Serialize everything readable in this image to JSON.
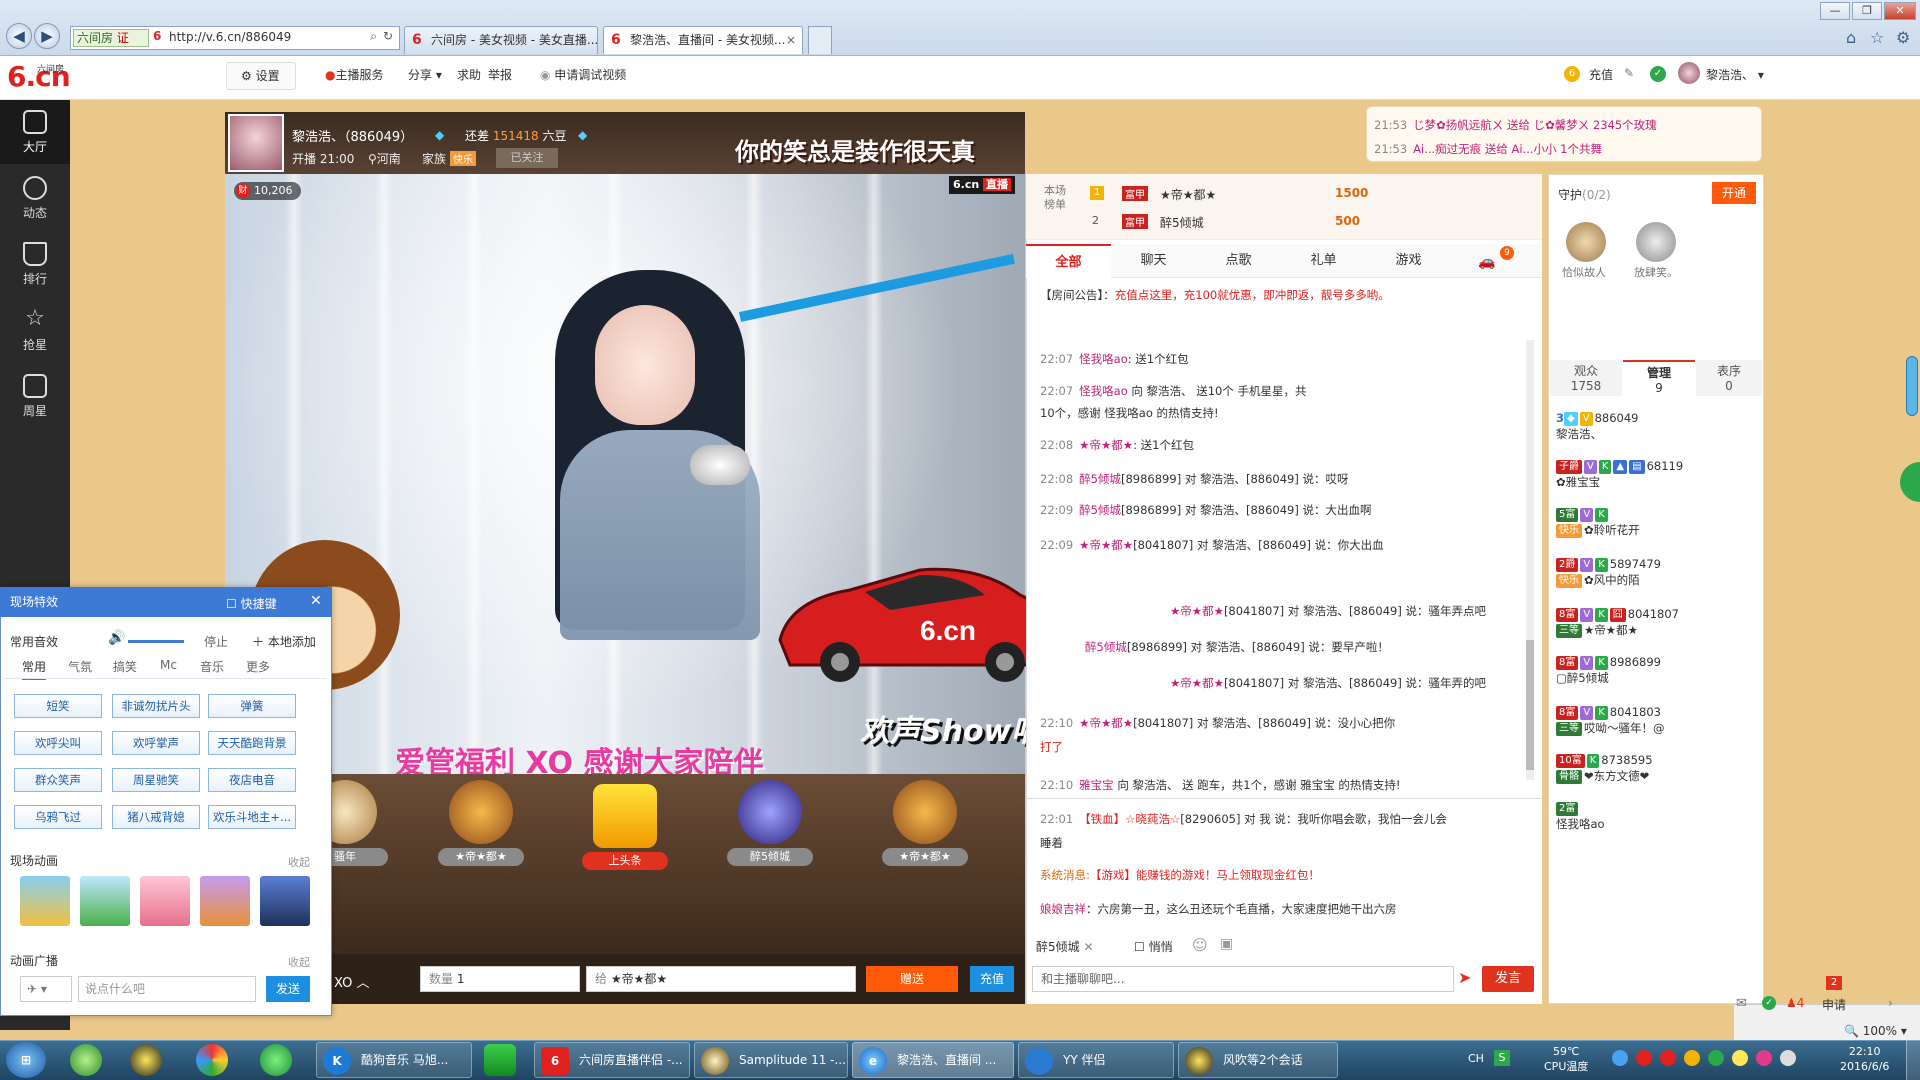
{
  "browser": {
    "url": "http://v.6.cn/886049",
    "zone": "六间房",
    "zone_badge": "证",
    "tabs": [
      {
        "title": "六间房 - 美女视频 - 美女直播..."
      },
      {
        "title": "黎浩浩、直播间 - 美女视频..."
      }
    ],
    "close_glyph": "×"
  },
  "site": {
    "logo_text": "6.cn",
    "logo_small": "六间房",
    "settings": "设置",
    "anchor_service": "主播服务",
    "share": "分享",
    "help": "求助",
    "report": "举报",
    "apply_debug": "申请调试视频",
    "recharge": "充值",
    "username": "黎浩浩、"
  },
  "rail": [
    {
      "label": "大厅"
    },
    {
      "label": "动态"
    },
    {
      "label": "排行"
    },
    {
      "label": "抢星"
    },
    {
      "label": "周星"
    }
  ],
  "anchor": {
    "name": "黎浩浩、（886049）",
    "diff_label": "还差",
    "diff_value": "151418",
    "diff_unit": "六豆",
    "start_time": "开播 21:00",
    "location": "河南",
    "family": "家族",
    "family_badge": "快乐",
    "follow": "已关注",
    "fans_count": "10,206",
    "fans_badge": "财",
    "banner": "你的笑总是装作很天真",
    "video_logo": "6.cn",
    "video_live": "直播"
  },
  "video": {
    "bottom_text": "爱管福利 XO  感谢大家陪伴",
    "show_logo": "欢声Show唱"
  },
  "gift_slots": [
    {
      "name": "骚年"
    },
    {
      "name": "★帝★都★"
    },
    {
      "name": "上头条"
    },
    {
      "name": "醉5倾城"
    },
    {
      "name": "★帝★都★"
    }
  ],
  "controls": {
    "song": "XO",
    "quantity_label": "数量",
    "quantity_value": "1",
    "to_label": "给",
    "to_value": "★帝★都★",
    "give": "赠送",
    "recharge": "充值"
  },
  "rank": {
    "label": "本场榜单",
    "rows": [
      {
        "rank": "1",
        "lv": "富甲",
        "name": "★帝★都★",
        "score": "1500"
      },
      {
        "rank": "2",
        "lv": "富甲",
        "name": "醉5倾城",
        "score": "500"
      }
    ]
  },
  "chat_tabs": [
    {
      "label": "全部"
    },
    {
      "label": "聊天"
    },
    {
      "label": "点歌"
    },
    {
      "label": "礼单"
    },
    {
      "label": "游戏"
    }
  ],
  "car_badge": "9",
  "notice": {
    "label": "【房间公告】：",
    "text": "充值点这里，充100就优惠，即冲即返，靓号多多哟。"
  },
  "messages": [
    {
      "time": "22:07",
      "user": "怪我咯ao",
      "text": ": 送1个红包"
    },
    {
      "time": "22:07",
      "user": "怪我咯ao",
      "text": "向 黎浩浩、 送10个 手机星星，共"
    },
    {
      "time": "",
      "user": "",
      "text": "10个，感谢 怪我咯ao 的热情支持!"
    },
    {
      "time": "22:08",
      "user": "★帝★都★",
      "text": ": 送1个红包"
    },
    {
      "time": "22:08",
      "user": "醉5倾城",
      "text": "[8986899] 对 黎浩浩、[886049] 说：哎呀"
    },
    {
      "time": "22:09",
      "user": "醉5倾城",
      "text": "[8986899] 对 黎浩浩、[886049] 说：大出血啊"
    },
    {
      "time": "22:09",
      "user": "★帝★都★",
      "text": "[8041807] 对 黎浩浩、[886049] 说：你大出血"
    },
    {
      "time": "",
      "user": "★帝★都★",
      "text": "[8041807] 对 黎浩浩、[886049] 说：骚年弄点吧"
    },
    {
      "time": "",
      "user": "醉5倾城",
      "text": "[8986899] 对 黎浩浩、[886049] 说：要早产啦！"
    },
    {
      "time": "",
      "user": "★帝★都★",
      "text": "[8041807] 对 黎浩浩、[886049] 说：骚年弄的吧"
    },
    {
      "time": "22:10",
      "user": "★帝★都★",
      "text": "[8041807] 对 黎浩浩、[886049] 说：没小心把你"
    },
    {
      "time": "",
      "user": "",
      "text": "打了"
    },
    {
      "time": "22:10",
      "user": "雅宝宝",
      "text": "向 黎浩浩、 送 跑车，共1个，感谢 雅宝宝 的热情支持!"
    }
  ],
  "private_messages": [
    {
      "time": "22:01",
      "user": "【铁血】☆晓莼浩☆",
      "text": "[8290605] 对 我 说：我听你唱会歌，我怕一会儿会"
    },
    {
      "time": "",
      "user": "",
      "text": "睡着"
    },
    {
      "time": "",
      "user": "系统消息:",
      "text": "【游戏】能赚钱的游戏！马上领取现金红包！"
    },
    {
      "time": "",
      "user": "娘娘吉祥",
      "text": "：六房第一丑，这么丑还玩个毛直播，大家速度把她干出六房"
    }
  ],
  "chat_target": {
    "name": "醉5倾城",
    "whisper": "悄悄",
    "placeholder": "和主播聊聊吧...",
    "send": "发言"
  },
  "gift_top": [
    {
      "time": "21:53",
      "text": "じ梦✿扬帆远航ㄨ 送给 じ✿馨梦ㄨ 2345个玫瑰"
    },
    {
      "time": "21:53",
      "text": "Ai...痴过无痕 送给 Ai...小小 1个共舞"
    }
  ],
  "guard": {
    "title": "守护",
    "count": "(0/2)",
    "open": "开通",
    "members": [
      {
        "name": "恰似故人"
      },
      {
        "name": "放肆笑。"
      }
    ]
  },
  "user_tabs": [
    {
      "label": "观众",
      "count": "1758"
    },
    {
      "label": "管理",
      "count": "9"
    },
    {
      "label": "表序",
      "count": "0"
    }
  ],
  "users": [
    {
      "id": "886049",
      "name": "黎浩浩、"
    },
    {
      "id": "68119",
      "name": "✿雅宝宝"
    },
    {
      "id": "",
      "name": "✿聆听花开"
    },
    {
      "id": "5897479",
      "name": "✿风中的陌"
    },
    {
      "id": "8041807",
      "name": "★帝★都★"
    },
    {
      "id": "8986899",
      "name": "醉5倾城"
    },
    {
      "id": "8041803",
      "name": "哎呦～骚年！@"
    },
    {
      "id": "8738595",
      "name": "❤东方文德❤"
    },
    {
      "id": "",
      "name": "怪我咯ao"
    }
  ],
  "fx": {
    "title": "现场特效",
    "hotkey": "快捷键",
    "sound_label": "常用音效",
    "stop": "停止",
    "add_local": "本地添加",
    "tabs": [
      {
        "label": "常用"
      },
      {
        "label": "气氛"
      },
      {
        "label": "搞笑"
      },
      {
        "label": "Mc"
      },
      {
        "label": "音乐"
      },
      {
        "label": "更多"
      }
    ],
    "buttons": [
      {
        "label": "短笑"
      },
      {
        "label": "非诚勿扰片头"
      },
      {
        "label": "弹簧"
      },
      {
        "label": "欢呼尖叫"
      },
      {
        "label": "欢呼掌声"
      },
      {
        "label": "天天酷跑背景"
      },
      {
        "label": "群众笑声"
      },
      {
        "label": "周星驰笑"
      },
      {
        "label": "夜店电音"
      },
      {
        "label": "乌鸦飞过"
      },
      {
        "label": "猪八戒背媳"
      },
      {
        "label": "欢乐斗地主+..."
      }
    ],
    "anim_label": "现场动画",
    "collapse": "收起",
    "broadcast_label": "动画广播",
    "broadcast_placeholder": "说点什么吧",
    "send": "发送"
  },
  "status": {
    "zoom": "100%",
    "apply": "申请",
    "apply_badge": "2",
    "count4": "4"
  },
  "taskbar": {
    "tasks": [
      {
        "label": "酷狗音乐 马旭..."
      },
      {
        "label": "六间房直播伴侣 -..."
      },
      {
        "label": "Samplitude 11 -..."
      },
      {
        "label": "黎浩浩、直播间 ..."
      },
      {
        "label": "YY 伴侣"
      },
      {
        "label": "风吹等2个会话"
      }
    ],
    "lang": "CH",
    "temp": "59℃",
    "temp_label": "CPU温度",
    "time": "22:10",
    "date": "2016/6/6"
  }
}
